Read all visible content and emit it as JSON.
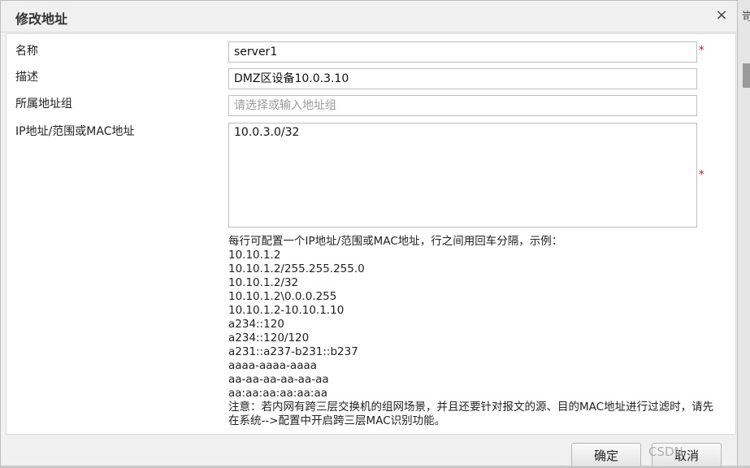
{
  "dialog": {
    "title": "修改地址",
    "close_icon": "×"
  },
  "form": {
    "name": {
      "label": "名称",
      "value": "server1",
      "required_mark": "*"
    },
    "description": {
      "label": "描述",
      "value": "DMZ区设备10.0.3.10"
    },
    "address_group": {
      "label": "所属地址组",
      "placeholder": "请选择或输入地址组"
    },
    "ip_list": {
      "label": "IP地址/范围或MAC地址",
      "value": "10.0.3.0/32",
      "required_mark": "*"
    }
  },
  "help": {
    "intro": "每行可配置一个IP地址/范围或MAC地址，行之间用回车分隔，示例：",
    "examples": [
      "10.10.1.2",
      "10.10.1.2/255.255.255.0",
      "10.10.1.2/32",
      "10.10.1.2\\0.0.0.255",
      "10.10.1.2-10.10.1.10",
      "a234::120",
      "a234::120/120",
      "a231::a237-b231::b237",
      "aaaa-aaaa-aaaa",
      "aa-aa-aa-aa-aa-aa",
      "aa:aa:aa:aa:aa:aa"
    ],
    "note": "注意：若内网有跨三层交换机的组网场景，并且还要针对报文的源、目的MAC地址进行过滤时，请先在系统-->配置中开启跨三层MAC识别功能。"
  },
  "buttons": {
    "ok": "确定",
    "cancel": "取消"
  },
  "watermark": "CSDN",
  "background": {
    "edge_text": "岢"
  }
}
